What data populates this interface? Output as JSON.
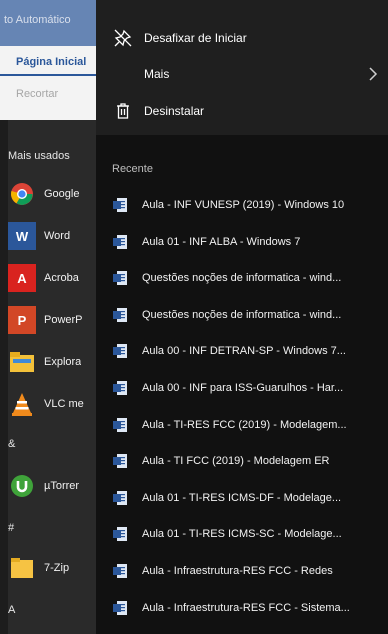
{
  "word_window": {
    "title": "to Automático",
    "tab": "Página Inicial",
    "ribbon_item": "Recortar"
  },
  "app_list": {
    "section_most_used": "Mais usados",
    "apps": [
      {
        "label": "Google",
        "icon": "chrome-icon",
        "color": "#4285f4"
      },
      {
        "label": "Word",
        "icon": "word-icon",
        "color": "#2b579a"
      },
      {
        "label": "Acroba",
        "icon": "acrobat-icon",
        "color": "#d9231f"
      },
      {
        "label": "PowerP",
        "icon": "powerpoint-icon",
        "color": "#d24726"
      },
      {
        "label": "Explora",
        "icon": "explorer-icon",
        "color": "#f3c13a"
      },
      {
        "label": "VLC me",
        "icon": "vlc-icon",
        "color": "#f08a1c"
      }
    ],
    "section_amp": "&",
    "app_utorrent": {
      "label": "µTorrer",
      "icon": "utorrent-icon",
      "color": "#3fa33a"
    },
    "section_hash": "#",
    "app_7zip": {
      "label": "7-Zip",
      "icon": "7zip-folder-icon",
      "color": "#f6c343"
    },
    "section_a": "A"
  },
  "context_menu": {
    "unpin": "Desafixar de Iniciar",
    "more": "Mais",
    "uninstall": "Desinstalar"
  },
  "recent": {
    "header": "Recente",
    "items": [
      "Aula - INF VUNESP (2019) - Windows 10",
      "Aula 01 - INF ALBA - Windows 7",
      "Questões noções de informatica - wind...",
      "Questões noções de informatica - wind...",
      "Aula 00 - INF DETRAN-SP - Windows 7...",
      "Aula 00 - INF para ISS-Guarulhos - Har...",
      "Aula - TI-RES FCC (2019) - Modelagem...",
      "Aula - TI FCC (2019) - Modelagem ER",
      "Aula 01 - TI-RES ICMS-DF - Modelage...",
      "Aula 01 - TI-RES ICMS-SC - Modelage...",
      "Aula - Infraestrutura-RES FCC - Redes",
      "Aula - Infraestrutura-RES FCC - Sistema..."
    ]
  }
}
